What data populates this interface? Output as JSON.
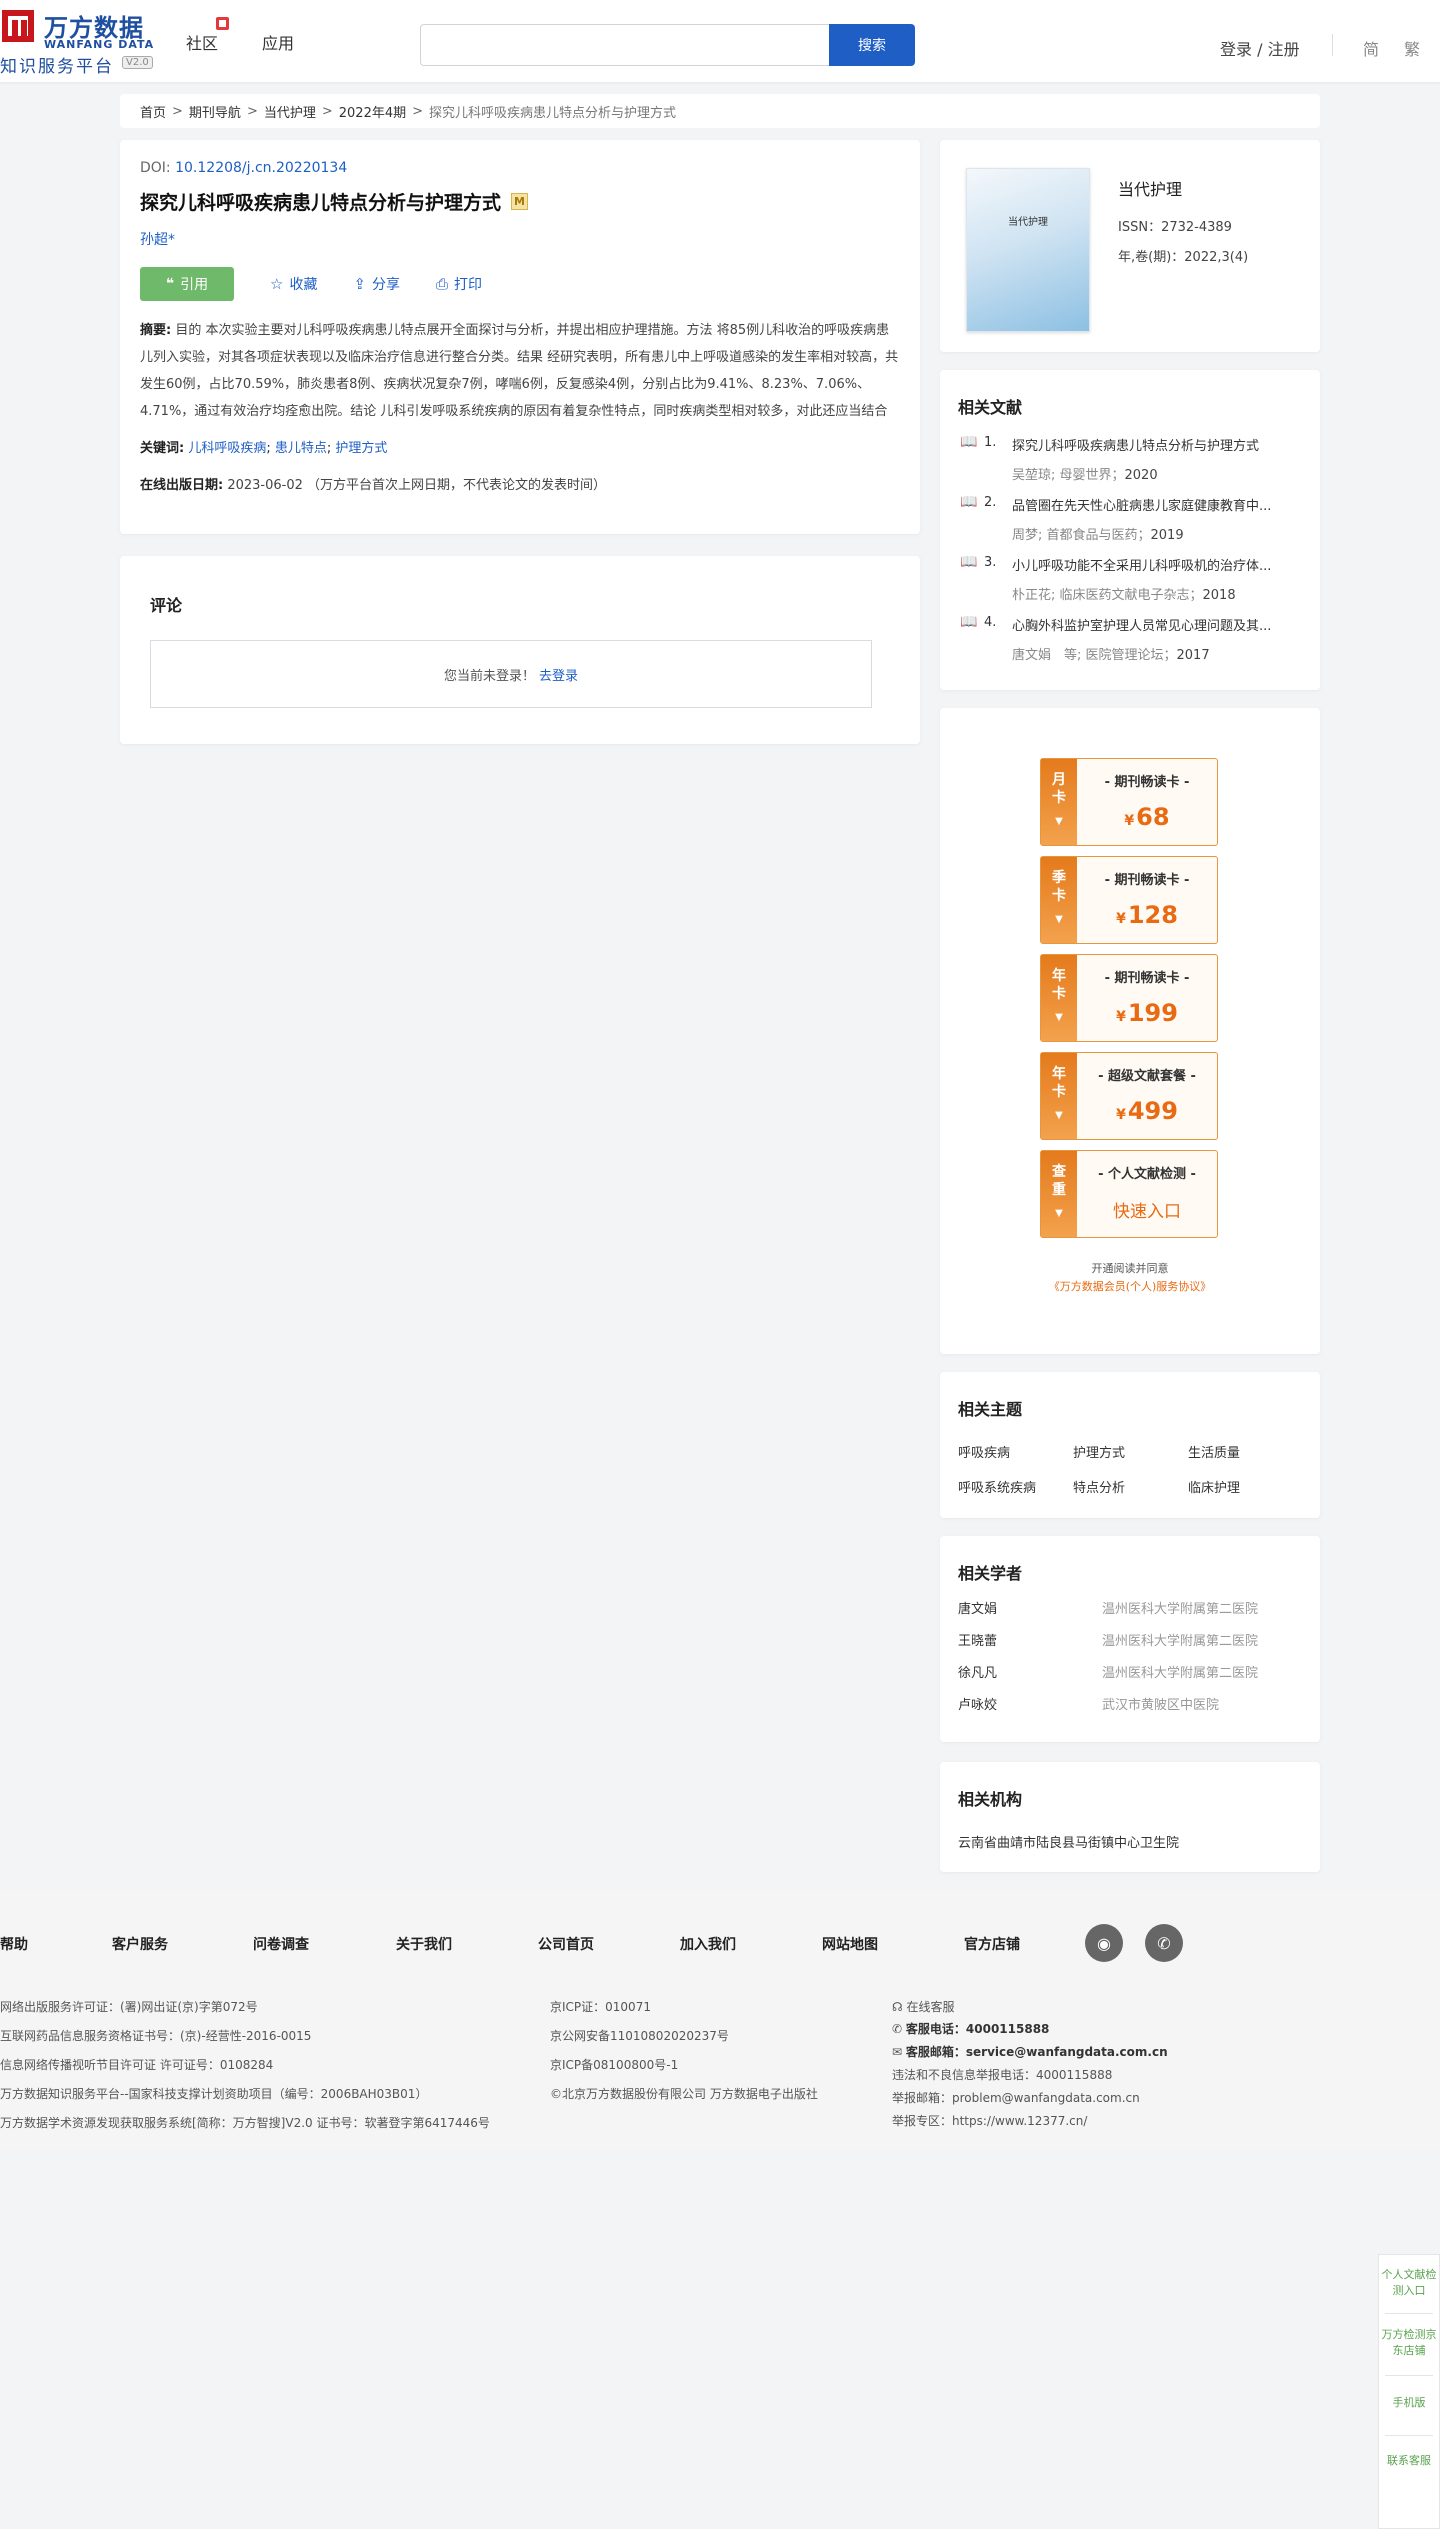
{
  "header": {
    "logo_cn": "万方数据",
    "logo_en": "WANFANG DATA",
    "logo_sub": "知识服务平台",
    "logo_version": "V2.0",
    "nav": [
      "社区",
      "应用"
    ],
    "search_placeholder": "",
    "search_button": "搜索",
    "login": "登录 / 注册",
    "lang_simplified": "简",
    "lang_traditional": "繁"
  },
  "breadcrumb": [
    "首页",
    "期刊导航",
    "当代护理",
    "2022年4期",
    "探究儿科呼吸疾病患儿特点分析与护理方式"
  ],
  "article": {
    "doi_label": "DOI:",
    "doi": "10.12208/j.cn.20220134",
    "title": "探究儿科呼吸疾病患儿特点分析与护理方式",
    "badge": "M",
    "author": "孙超*",
    "cite_label": "引用",
    "favorite_label": "收藏",
    "share_label": "分享",
    "print_label": "打印",
    "abstract_label": "摘要:",
    "abstract": "目的 本次实验主要对儿科呼吸疾病患儿特点展开全面探讨与分析，并提出相应护理措施。方法 将85例儿科收治的呼吸疾病患儿列入实验，对其各项症状表现以及临床治疗信息进行整合分类。结果 经研究表明，所有患儿中上呼吸道感染的发生率相对较高，共发生60例，占比70.59%，肺炎患者8例、疾病状况复杂7例，哮喘6例，反复感染4例，分别占比为9.41%、8.23%、7.06%、4.71%，通过有效治疗均痊愈出院。结论 儿科引发呼吸系统疾病的原因有着复杂性特点，同时疾病类型相对较多，对此还应当结合患儿的实际情况展开针对性治疗，并在此基础上配合科学合理的护理方案，从而才能...",
    "keywords_label": "关键词:",
    "keywords": [
      "儿科呼吸疾病",
      "患儿特点",
      "护理方式"
    ],
    "online_date_label": "在线出版日期:",
    "online_date": "2023-06-02",
    "online_date_note": "（万方平台首次上网日期，不代表论文的发表时间）"
  },
  "comment": {
    "title": "评论",
    "not_logged": "您当前未登录！",
    "login_link": "去登录"
  },
  "journal": {
    "cover_text": "当代护理",
    "name": "当代护理",
    "issn": "ISSN：2732-4389",
    "issue": "年,卷(期)：2022,3(4)"
  },
  "related_docs": {
    "title": "相关文献",
    "items": [
      {
        "num": "1.",
        "title": "探究儿科呼吸疾病患儿特点分析与护理方式",
        "meta": "吴堃琼; 母婴世界；",
        "year": "2020"
      },
      {
        "num": "2.",
        "title": "品管圈在先天性心脏病患儿家庭健康教育中...",
        "meta": "周梦; 首都食品与医药；",
        "year": "2019"
      },
      {
        "num": "3.",
        "title": "小儿呼吸功能不全采用儿科呼吸机的治疗体...",
        "meta": "朴正花; 临床医药文献电子杂志；",
        "year": "2018"
      },
      {
        "num": "4.",
        "title": "心胸外科监护室护理人员常见心理问题及其...",
        "meta": "唐文娟　等; 医院管理论坛；",
        "year": "2017"
      }
    ]
  },
  "vip_cards": [
    {
      "side": [
        "月",
        "卡"
      ],
      "name": "- 期刊畅读卡 -",
      "price": "68",
      "currency": "¥"
    },
    {
      "side": [
        "季",
        "卡"
      ],
      "name": "- 期刊畅读卡 -",
      "price": "128",
      "currency": "¥"
    },
    {
      "side": [
        "年",
        "卡"
      ],
      "name": "- 期刊畅读卡 -",
      "price": "199",
      "currency": "¥"
    },
    {
      "side": [
        "年",
        "卡"
      ],
      "name": "- 超级文献套餐 -",
      "price": "499",
      "currency": "¥"
    },
    {
      "side": [
        "查",
        "重"
      ],
      "name": "- 个人文献检测 -",
      "link": "快速入口"
    }
  ],
  "vip_footer": {
    "line1": "开通阅读并同意",
    "line2": "《万方数据会员(个人)服务协议》"
  },
  "topics": {
    "title": "相关主题",
    "items": [
      "呼吸疾病",
      "护理方式",
      "生活质量",
      "呼吸系统疾病",
      "特点分析",
      "临床护理"
    ]
  },
  "scholars": {
    "title": "相关学者",
    "items": [
      {
        "name": "唐文娟",
        "org": "温州医科大学附属第二医院"
      },
      {
        "name": "王晓蕾",
        "org": "温州医科大学附属第二医院"
      },
      {
        "name": "徐凡凡",
        "org": "温州医科大学附属第二医院"
      },
      {
        "name": "卢咏姣",
        "org": "武汉市黄陂区中医院"
      }
    ]
  },
  "orgs": {
    "title": "相关机构",
    "items": [
      "云南省曲靖市陆良县马街镇中心卫生院"
    ]
  },
  "footer": {
    "links": [
      "帮助",
      "客户服务",
      "问卷调查",
      "关于我们",
      "公司首页",
      "加入我们",
      "网站地图",
      "官方店铺"
    ],
    "col1": [
      "网络出版服务许可证：(署)网出证(京)字第072号",
      "互联网药品信息服务资格证书号：(京)-经营性-2016-0015",
      "信息网络传播视听节目许可证 许可证号：0108284",
      "万方数据知识服务平台--国家科技支撑计划资助项目（编号：2006BAH03B01）",
      "万方数据学术资源发现获取服务系统[简称：万方智搜]V2.0 证书号：软著登字第6417446号"
    ],
    "col2": [
      "京ICP证：010071",
      "京公网安备11010802020237号",
      "京ICP备08100800号-1",
      "©北京万方数据股份有限公司 万方数据电子出版社"
    ],
    "online_service": "在线客服",
    "phone_label": "客服电话：",
    "phone": "4000115888",
    "email_label": "客服邮箱：",
    "email": "service@wanfangdata.com.cn",
    "report_phone": "违法和不良信息举报电话：4000115888",
    "report_email": "举报邮箱：problem@wanfangdata.com.cn",
    "report_zone": "举报专区：https://www.12377.cn/"
  },
  "side_float": [
    "个人文献检测入口",
    "万方检测京东店铺",
    "手机版",
    "联系客服"
  ]
}
